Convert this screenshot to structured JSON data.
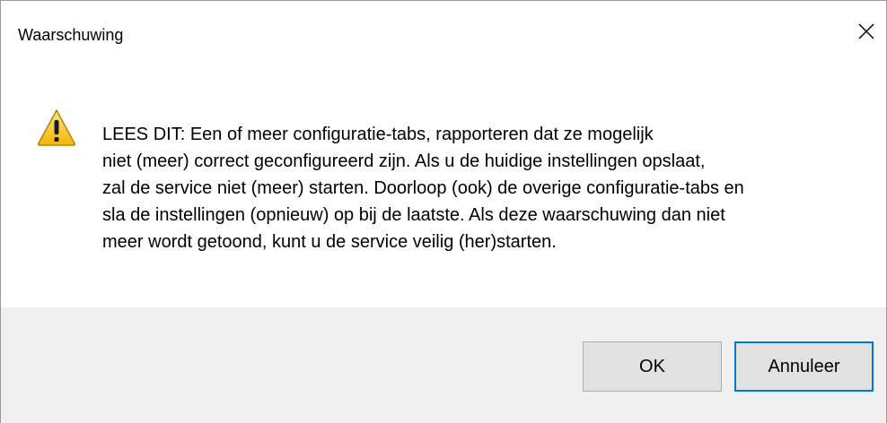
{
  "window": {
    "title": "Waarschuwing",
    "close_glyph": "✕"
  },
  "message": {
    "icon": "warning-icon",
    "lines": [
      "LEES DIT: Een of meer configuratie-tabs, rapporteren dat ze mogelijk",
      "niet (meer) correct geconfigureerd zijn. Als u de huidige instellingen opslaat,",
      "zal de service niet (meer) starten. Doorloop (ook) de overige configuratie-tabs en",
      "sla de instellingen (opnieuw) op bij de laatste. Als deze waarschuwing dan niet",
      "meer wordt getoond, kunt u de service veilig (her)starten."
    ]
  },
  "buttons": {
    "ok_label": "OK",
    "cancel_label": "Annuleer"
  },
  "colors": {
    "footer_bg": "#f0f0f0",
    "focus_border": "#0078d7",
    "warning_yellow": "#f6c21c"
  }
}
